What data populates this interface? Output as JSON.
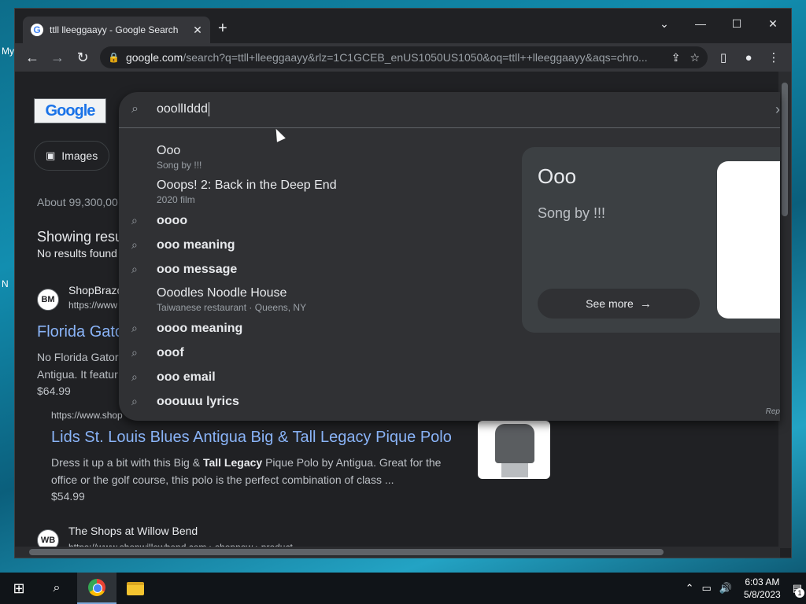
{
  "desktop": {
    "icon_label": "My",
    "icon_n": "N"
  },
  "browser": {
    "tab_title": "ttll lleeggaayy - Google Search",
    "tab_close": "✕",
    "new_tab": "+",
    "url_host": "google.com",
    "url_rest": "/search?q=ttll+lleeggaayy&rlz=1C1GCEB_enUS1050US1050&oq=ttll++lleeggaayy&aqs=chro..."
  },
  "page": {
    "logo_text": "Google",
    "images_chip": "Images",
    "result_count": "About 99,300,00",
    "showing": "Showing resu",
    "no_results": "No results found",
    "results": [
      {
        "logo": "BM",
        "site": "ShopBrazo",
        "cite": "https://www",
        "title": "Florida Gator",
        "snippet_1": "No Florida Gators",
        "snippet_2": "Antigua. It featur",
        "price": "$64.99"
      },
      {
        "cite": "https://www.shop",
        "title": "Lids St. Louis Blues Antigua Big & Tall Legacy Pique Polo",
        "snippet_a": "Dress it up a bit with this Big & ",
        "snippet_bold": "Tall Legacy",
        "snippet_b": " Pique Polo by Antigua. Great for the office or the golf course, this polo is the perfect combination of class ...",
        "price": "$54.99"
      },
      {
        "logo": "WB",
        "site": "The Shops at Willow Bend",
        "cite": "https://www.shopwillowbend.com › shopnow › product"
      }
    ]
  },
  "dropdown": {
    "query": "ooollIddd",
    "suggestions": [
      {
        "text": "Ooo",
        "sub": "Song by !!!"
      },
      {
        "text": "Ooops! 2: Back in the Deep End",
        "sub": "2020 film"
      },
      {
        "prefix": "oooo",
        "bold": ""
      },
      {
        "prefix": "ooo",
        "bold": " meaning"
      },
      {
        "prefix": "ooo",
        "bold": " message"
      },
      {
        "text": "Ooodles Noodle House",
        "sub": "Taiwanese restaurant · Queens, NY"
      },
      {
        "prefix": "oooo",
        "bold": " meaning"
      },
      {
        "prefix": "ooof",
        "bold": ""
      },
      {
        "prefix": "ooo",
        "bold": " email"
      },
      {
        "prefix": "ooouuu",
        "bold": " lyrics"
      }
    ],
    "panel": {
      "title": "Ooo",
      "subtitle": "Song by !!!",
      "see_more": "See more"
    },
    "report": "Rep"
  },
  "taskbar": {
    "time": "6:03 AM",
    "date": "5/8/2023",
    "notifications": "1"
  },
  "colors": {
    "link": "#8ab4f8",
    "bg": "#202124",
    "dropdown": "#303134"
  }
}
